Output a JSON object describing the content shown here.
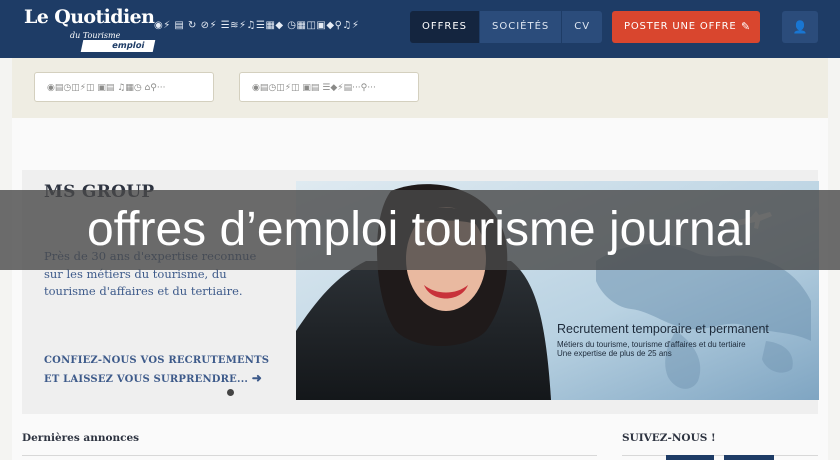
{
  "header": {
    "logo": {
      "main": "Le Quotidien",
      "sub": "du Tourisme",
      "tag": "emploi"
    },
    "icon_strip": "◉⚡ ▤ ↻ ⊘⚡ ☰≋⚡♫☰▦◆ ◷▦◫▣◆⚲♫⚡",
    "tabs": [
      {
        "label": "OFFRES"
      },
      {
        "label": "SOCIÉTÉS"
      },
      {
        "label": "CV"
      }
    ],
    "post_button": "POSTER UNE OFFRE",
    "post_icon": "✎",
    "user_icon": "👤"
  },
  "filters": {
    "field1": "◉▤◷◫⚡◫  ▣▤ ♫▦◷  ⌂⚲···",
    "field2": "◉▤◷◫⚡◫  ▣▤  ☰◆⚡▤···⚲···"
  },
  "slide": {
    "company": "MS GROUP",
    "description": "Près de 30 ans d'expertise reconnue sur les métiers du tourisme, du tourisme d'affaires et du tertiaire.",
    "cta_line1": "CONFIEZ-NOUS VOS RECRUTEMENTS",
    "cta_line2": "ET LAISSEZ VOUS SURPRENDRE...",
    "banner_title": "Recrutement temporaire et permanent",
    "banner_line1": "Métiers du tourisme, tourisme d'affaires et du tertiaire",
    "banner_line2": "Une expertise de plus de 25 ans"
  },
  "sections": {
    "latest": "Dernières annonces",
    "follow": "SUIVEZ-NOUS !"
  },
  "overlay_caption": "offres d’emploi tourisme journal",
  "colors": {
    "navbar": "#1e3c66",
    "accent": "#d9462e",
    "link": "#3d5a8a"
  }
}
